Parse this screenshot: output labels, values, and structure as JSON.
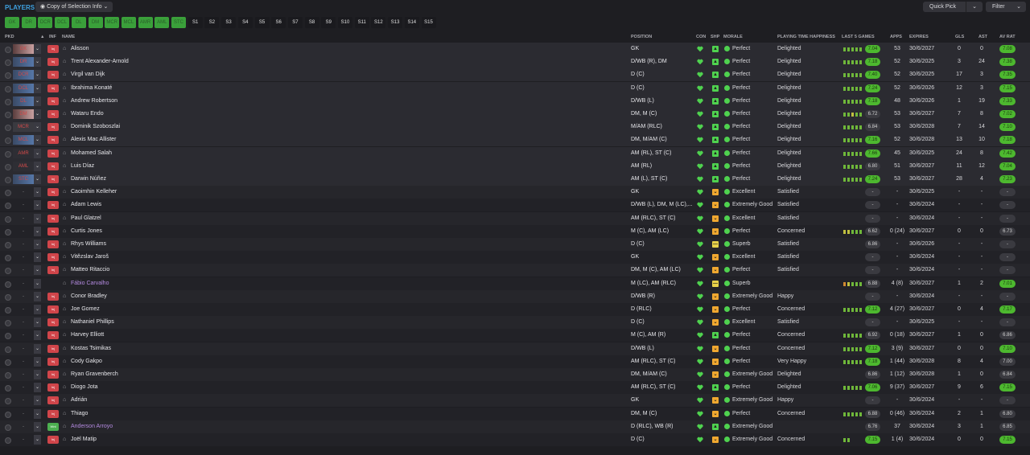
{
  "header": {
    "title": "PLAYERS",
    "view_label": "Copy of Selection Info",
    "quick_pick_label": "Quick Pick",
    "filter_label": "Filter"
  },
  "position_chips": [
    "GK",
    "DR",
    "DCR",
    "DCL",
    "DL",
    "DM",
    "MCR",
    "MCL",
    "AMR",
    "AML",
    "STC"
  ],
  "sub_chips": [
    "S1",
    "S2",
    "S3",
    "S4",
    "S5",
    "S6",
    "S7",
    "S8",
    "S9",
    "S10",
    "S11",
    "S12",
    "S13",
    "S14",
    "S15"
  ],
  "columns": {
    "pkd": "PKD",
    "inf": "INF",
    "name": "NAME",
    "position": "POSITION",
    "con": "CON",
    "shp": "SHP",
    "morale": "MORALE",
    "pth": "PLAYING TIME HAPPINESS",
    "last5": "LAST 5 GAMES",
    "apps": "APPS",
    "expires": "EXPIRES",
    "gls": "GLS",
    "ast": "AST",
    "avr": "AV RAT"
  },
  "colors": {
    "positive": "#4db82f",
    "warning": "#f0a830",
    "loan_name": "#b48ae0",
    "accent": "#3fa1e0"
  },
  "rows": [
    {
      "slot": "GK",
      "slot_style": "gk",
      "inf": "Inj",
      "inf_color": "red",
      "name": "Alisson",
      "loan": false,
      "position": "GK",
      "shp": "g",
      "morale": "Perfect",
      "pth": "Delighted",
      "l5": "ggggg",
      "avg": "7.04",
      "avg_green": true,
      "apps": "53",
      "expires": "30/6/2027",
      "gls": "0",
      "ast": "0",
      "avr": "7.08",
      "avr_green": true
    },
    {
      "slot": "DR",
      "slot_style": "def",
      "inf": "Inj",
      "inf_color": "red",
      "name": "Trent Alexander-Arnold",
      "loan": false,
      "position": "D/WB (R), DM",
      "shp": "g",
      "morale": "Perfect",
      "pth": "Delighted",
      "l5": "ggggg",
      "avg": "7.18",
      "avg_green": true,
      "apps": "52",
      "expires": "30/6/2025",
      "gls": "3",
      "ast": "24",
      "avr": "7.38",
      "avr_green": true
    },
    {
      "slot": "DCR",
      "slot_style": "def",
      "inf": "Inj",
      "inf_color": "red",
      "name": "Virgil van Dijk",
      "loan": false,
      "position": "D (C)",
      "shp": "g",
      "morale": "Perfect",
      "pth": "Delighted",
      "l5": "ggggg",
      "avg": "7.40",
      "avg_green": true,
      "apps": "52",
      "expires": "30/6/2025",
      "gls": "17",
      "ast": "3",
      "avr": "7.35",
      "avr_green": true
    },
    {
      "slot": "DCL",
      "slot_style": "def",
      "inf": "Inj",
      "inf_color": "red",
      "name": "Ibrahima Konaté",
      "loan": false,
      "position": "D (C)",
      "shp": "g",
      "morale": "Perfect",
      "pth": "Delighted",
      "l5": "ggggg",
      "avg": "7.24",
      "avg_green": true,
      "apps": "52",
      "expires": "30/6/2026",
      "gls": "12",
      "ast": "3",
      "avr": "7.15",
      "avr_green": true
    },
    {
      "slot": "DL",
      "slot_style": "def",
      "inf": "Inj",
      "inf_color": "red",
      "name": "Andrew Robertson",
      "loan": false,
      "position": "D/WB (L)",
      "shp": "g",
      "morale": "Perfect",
      "pth": "Delighted",
      "l5": "ggggg",
      "avg": "7.18",
      "avg_green": true,
      "apps": "48",
      "expires": "30/6/2026",
      "gls": "1",
      "ast": "19",
      "avr": "7.33",
      "avr_green": true
    },
    {
      "slot": "DM",
      "slot_style": "gk",
      "inf": "Inj",
      "inf_color": "red",
      "name": "Wataru Endo",
      "loan": false,
      "position": "DM, M (C)",
      "shp": "g",
      "morale": "Perfect",
      "pth": "Delighted",
      "l5": "ggygg",
      "avg": "6.72",
      "avg_green": false,
      "apps": "53",
      "expires": "30/6/2027",
      "gls": "7",
      "ast": "8",
      "avr": "7.02",
      "avr_green": true
    },
    {
      "slot": "MCR",
      "slot_style": "mid",
      "inf": "Inj",
      "inf_color": "red",
      "name": "Dominik Szoboszlai",
      "loan": false,
      "position": "M/AM (RLC)",
      "shp": "g",
      "morale": "Perfect",
      "pth": "Delighted",
      "l5": "ggggg",
      "avg": "6.84",
      "avg_green": false,
      "apps": "53",
      "expires": "30/6/2028",
      "gls": "7",
      "ast": "14",
      "avr": "7.10",
      "avr_green": true
    },
    {
      "slot": "MCL",
      "slot_style": "def",
      "inf": "Inj",
      "inf_color": "red",
      "name": "Alexis Mac Allister",
      "loan": false,
      "position": "DM, M/AM (C)",
      "shp": "g",
      "morale": "Perfect",
      "pth": "Delighted",
      "l5": "ggggg",
      "avg": "7.16",
      "avg_green": true,
      "apps": "52",
      "expires": "30/6/2028",
      "gls": "13",
      "ast": "10",
      "avr": "7.18",
      "avr_green": true
    },
    {
      "slot": "AMR",
      "slot_style": "att",
      "inf": "Inj",
      "inf_color": "red",
      "name": "Mohamed Salah",
      "loan": false,
      "position": "AM (RL), ST (C)",
      "shp": "g",
      "morale": "Perfect",
      "pth": "Delighted",
      "l5": "ggggg",
      "avg": "7.66",
      "avg_green": true,
      "apps": "45",
      "expires": "30/6/2025",
      "gls": "24",
      "ast": "8",
      "avr": "7.42",
      "avr_green": true
    },
    {
      "slot": "AML",
      "slot_style": "att",
      "inf": "Inj",
      "inf_color": "red",
      "name": "Luis Díaz",
      "loan": false,
      "position": "AM (RL)",
      "shp": "g",
      "morale": "Perfect",
      "pth": "Delighted",
      "l5": "ggggg",
      "avg": "6.80",
      "avg_green": false,
      "apps": "51",
      "expires": "30/6/2027",
      "gls": "11",
      "ast": "12",
      "avr": "7.04",
      "avr_green": true
    },
    {
      "slot": "STC",
      "slot_style": "def",
      "inf": "Inj",
      "inf_color": "red",
      "name": "Darwin Núñez",
      "loan": false,
      "position": "AM (L), ST (C)",
      "shp": "g",
      "morale": "Perfect",
      "pth": "Delighted",
      "l5": "ggggg",
      "avg": "7.24",
      "avg_green": true,
      "apps": "53",
      "expires": "30/6/2027",
      "gls": "28",
      "ast": "4",
      "avr": "7.23",
      "avr_green": true
    },
    {
      "slot": "-",
      "slot_style": "plain",
      "inf": "Inj",
      "inf_color": "red",
      "name": "Caoimhin Kelleher",
      "loan": false,
      "position": "GK",
      "shp": "o",
      "morale": "Excellent",
      "pth": "Satisfied",
      "l5": "",
      "avg": "-",
      "avg_green": false,
      "apps": "-",
      "expires": "30/6/2025",
      "gls": "-",
      "ast": "-",
      "avr": "-",
      "avr_green": false
    },
    {
      "slot": "-",
      "slot_style": "plain",
      "inf": "Inj",
      "inf_color": "red",
      "name": "Adam Lewis",
      "loan": false,
      "position": "D/WB (L), DM, M (LC),...",
      "shp": "o",
      "morale": "Extremely Good",
      "pth": "Satisfied",
      "l5": "",
      "avg": "-",
      "avg_green": false,
      "apps": "-",
      "expires": "30/6/2024",
      "gls": "-",
      "ast": "-",
      "avr": "-",
      "avr_green": false
    },
    {
      "slot": "-",
      "slot_style": "plain",
      "inf": "Inj",
      "inf_color": "red",
      "name": "Paul Glatzel",
      "loan": false,
      "position": "AM (RLC), ST (C)",
      "shp": "o",
      "morale": "Excellent",
      "pth": "Satisfied",
      "l5": "",
      "avg": "-",
      "avg_green": false,
      "apps": "-",
      "expires": "30/6/2024",
      "gls": "-",
      "ast": "-",
      "avr": "-",
      "avr_green": false
    },
    {
      "slot": "-",
      "slot_style": "plain",
      "inf": "Inj",
      "inf_color": "red",
      "name": "Curtis Jones",
      "loan": false,
      "position": "M (C), AM (LC)",
      "shp": "o",
      "morale": "Perfect",
      "pth": "Concerned",
      "l5": "yyggg",
      "avg": "6.62",
      "avg_green": false,
      "apps": "0 (24)",
      "expires": "30/6/2027",
      "gls": "0",
      "ast": "0",
      "avr": "6.73",
      "avr_green": false
    },
    {
      "slot": "-",
      "slot_style": "plain",
      "inf": "Inj",
      "inf_color": "red",
      "name": "Rhys Williams",
      "loan": false,
      "position": "D (C)",
      "shp": "y",
      "morale": "Superb",
      "pth": "Satisfied",
      "l5": "",
      "avg": "6.86",
      "avg_green": false,
      "apps": "-",
      "expires": "30/6/2026",
      "gls": "-",
      "ast": "-",
      "avr": "-",
      "avr_green": false
    },
    {
      "slot": "-",
      "slot_style": "plain",
      "inf": "Inj",
      "inf_color": "red",
      "name": "Vitězslav Jaroš",
      "loan": false,
      "position": "GK",
      "shp": "o",
      "morale": "Excellent",
      "pth": "Satisfied",
      "l5": "",
      "avg": "-",
      "avg_green": false,
      "apps": "-",
      "expires": "30/6/2024",
      "gls": "-",
      "ast": "-",
      "avr": "-",
      "avr_green": false
    },
    {
      "slot": "-",
      "slot_style": "plain",
      "inf": "Inj",
      "inf_color": "red",
      "name": "Matteo Ritaccio",
      "loan": false,
      "position": "DM, M (C), AM (LC)",
      "shp": "o",
      "morale": "Perfect",
      "pth": "Satisfied",
      "l5": "",
      "avg": "-",
      "avg_green": false,
      "apps": "-",
      "expires": "30/6/2024",
      "gls": "-",
      "ast": "-",
      "avr": "-",
      "avr_green": false
    },
    {
      "slot": "-",
      "slot_style": "plain",
      "inf": "",
      "inf_color": "none",
      "name": "Fábio Carvalho",
      "loan": true,
      "position": "M (LC), AM (RLC)",
      "shp": "y",
      "morale": "Superb",
      "pth": "",
      "l5": "oyggg",
      "avg": "6.88",
      "avg_green": false,
      "apps": "4 (8)",
      "expires": "30/6/2027",
      "gls": "1",
      "ast": "2",
      "avr": "7.01",
      "avr_green": true
    },
    {
      "slot": "-",
      "slot_style": "plain",
      "inf": "Inj",
      "inf_color": "red",
      "name": "Conor Bradley",
      "loan": false,
      "position": "D/WB (R)",
      "shp": "o",
      "morale": "Extremely Good",
      "pth": "Happy",
      "l5": "",
      "avg": "-",
      "avg_green": false,
      "apps": "-",
      "expires": "30/6/2024",
      "gls": "-",
      "ast": "-",
      "avr": "-",
      "avr_green": false
    },
    {
      "slot": "-",
      "slot_style": "plain",
      "inf": "Inj",
      "inf_color": "red",
      "name": "Joe Gomez",
      "loan": false,
      "position": "D (RLC)",
      "shp": "o",
      "morale": "Perfect",
      "pth": "Concerned",
      "l5": "ggggg",
      "avg": "7.12",
      "avg_green": true,
      "apps": "4 (27)",
      "expires": "30/6/2027",
      "gls": "0",
      "ast": "4",
      "avr": "7.17",
      "avr_green": true
    },
    {
      "slot": "-",
      "slot_style": "plain",
      "inf": "Inj",
      "inf_color": "red",
      "name": "Nathaniel Phillips",
      "loan": false,
      "position": "D (C)",
      "shp": "o",
      "morale": "Excellent",
      "pth": "Satisfied",
      "l5": "",
      "avg": "-",
      "avg_green": false,
      "apps": "-",
      "expires": "30/6/2025",
      "gls": "-",
      "ast": "-",
      "avr": "-",
      "avr_green": false
    },
    {
      "slot": "-",
      "slot_style": "plain",
      "inf": "Inj",
      "inf_color": "red",
      "name": "Harvey Elliott",
      "loan": false,
      "position": "M (C), AM (R)",
      "shp": "g",
      "morale": "Perfect",
      "pth": "Concerned",
      "l5": "ggggg",
      "avg": "6.92",
      "avg_green": false,
      "apps": "0 (18)",
      "expires": "30/6/2027",
      "gls": "1",
      "ast": "0",
      "avr": "6.86",
      "avr_green": false
    },
    {
      "slot": "-",
      "slot_style": "plain",
      "inf": "Inj",
      "inf_color": "red",
      "name": "Kostas Tsimikas",
      "loan": false,
      "position": "D/WB (L)",
      "shp": "o",
      "morale": "Perfect",
      "pth": "Concerned",
      "l5": "ggggg",
      "avg": "7.12",
      "avg_green": true,
      "apps": "3 (9)",
      "expires": "30/6/2027",
      "gls": "0",
      "ast": "0",
      "avr": "7.10",
      "avr_green": true
    },
    {
      "slot": "-",
      "slot_style": "plain",
      "inf": "Inj",
      "inf_color": "red",
      "name": "Cody Gakpo",
      "loan": false,
      "position": "AM (RLC), ST (C)",
      "shp": "o",
      "morale": "Perfect",
      "pth": "Very Happy",
      "l5": "ggggg",
      "avg": "7.18",
      "avg_green": true,
      "apps": "1 (44)",
      "expires": "30/6/2028",
      "gls": "8",
      "ast": "4",
      "avr": "7.00",
      "avr_green": false
    },
    {
      "slot": "-",
      "slot_style": "plain",
      "inf": "Inj",
      "inf_color": "red",
      "name": "Ryan Gravenberch",
      "loan": false,
      "position": "DM, M/AM (C)",
      "shp": "o",
      "morale": "Extremely Good",
      "pth": "Delighted",
      "l5": "",
      "avg": "6.86",
      "avg_green": false,
      "apps": "1 (12)",
      "expires": "30/6/2028",
      "gls": "1",
      "ast": "0",
      "avr": "6.84",
      "avr_green": false
    },
    {
      "slot": "-",
      "slot_style": "plain",
      "inf": "Inj",
      "inf_color": "red",
      "name": "Diogo Jota",
      "loan": false,
      "position": "AM (RLC), ST (C)",
      "shp": "g",
      "morale": "Perfect",
      "pth": "Delighted",
      "l5": "ggggg",
      "avg": "7.06",
      "avg_green": true,
      "apps": "9 (37)",
      "expires": "30/6/2027",
      "gls": "9",
      "ast": "6",
      "avr": "7.15",
      "avr_green": true
    },
    {
      "slot": "-",
      "slot_style": "plain",
      "inf": "Inj",
      "inf_color": "red",
      "name": "Adrián",
      "loan": false,
      "position": "GK",
      "shp": "o",
      "morale": "Extremely Good",
      "pth": "Happy",
      "l5": "",
      "avg": "-",
      "avg_green": false,
      "apps": "-",
      "expires": "30/6/2024",
      "gls": "-",
      "ast": "-",
      "avr": "-",
      "avr_green": false
    },
    {
      "slot": "-",
      "slot_style": "plain",
      "inf": "Inj",
      "inf_color": "red",
      "name": "Thiago",
      "loan": false,
      "position": "DM, M (C)",
      "shp": "o",
      "morale": "Perfect",
      "pth": "Concerned",
      "l5": "ggggg",
      "avg": "6.88",
      "avg_green": false,
      "apps": "0 (46)",
      "expires": "30/6/2024",
      "gls": "2",
      "ast": "1",
      "avr": "6.80",
      "avr_green": false
    },
    {
      "slot": "-",
      "slot_style": "plain",
      "inf": "Wnt",
      "inf_color": "green",
      "name": "Anderson Arroyo",
      "loan": true,
      "position": "D (RLC), WB (R)",
      "shp": "g",
      "morale": "Extremely Good",
      "pth": "",
      "l5": "",
      "avg": "6.76",
      "avg_green": false,
      "apps": "37",
      "expires": "30/6/2024",
      "gls": "3",
      "ast": "1",
      "avr": "6.85",
      "avr_green": false
    },
    {
      "slot": "-",
      "slot_style": "plain",
      "inf": "Inj",
      "inf_color": "red",
      "name": "Joël Matip",
      "loan": false,
      "position": "D (C)",
      "shp": "o",
      "morale": "Extremely Good",
      "pth": "Concerned",
      "l5": "gg",
      "avg": "7.15",
      "avg_green": true,
      "apps": "1 (4)",
      "expires": "30/6/2024",
      "gls": "0",
      "ast": "0",
      "avr": "7.15",
      "avr_green": true
    }
  ]
}
